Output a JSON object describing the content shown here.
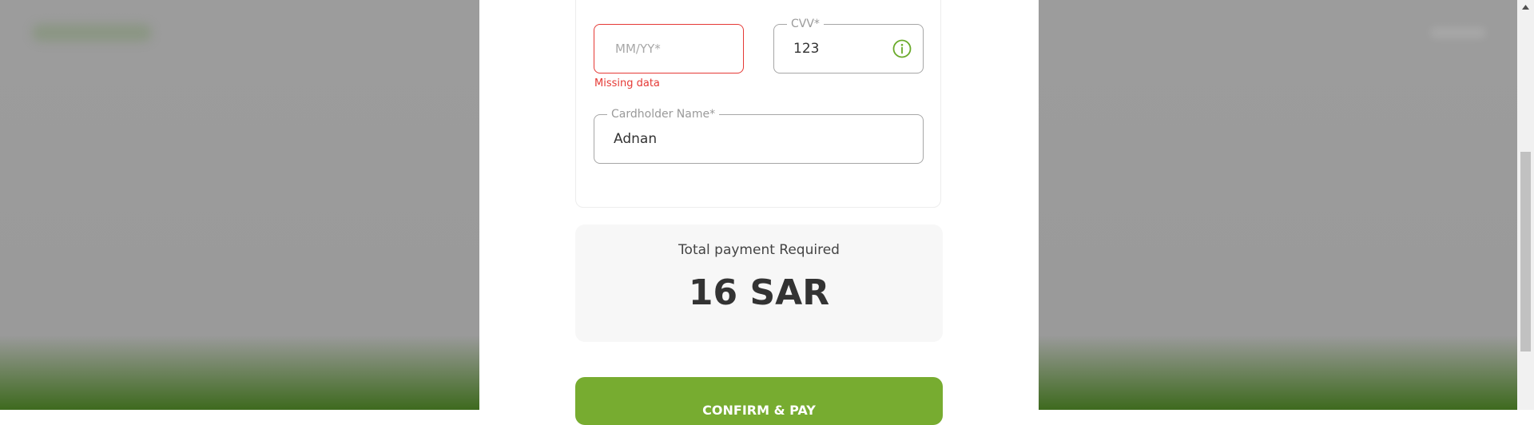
{
  "card_form": {
    "expiry": {
      "placeholder": "MM/YY*",
      "value": "",
      "error": "Missing data"
    },
    "cvv": {
      "label": "CVV*",
      "value": "123",
      "icon": "info-icon"
    },
    "cardholder": {
      "label": "Cardholder Name*",
      "value": "Adnan"
    }
  },
  "summary": {
    "label": "Total payment Required",
    "amount": "16 SAR"
  },
  "actions": {
    "confirm_label": "CONFIRM & PAY"
  },
  "colors": {
    "accent": "#77ac30",
    "error": "#e53935",
    "info_icon": "#6aaa2a"
  }
}
